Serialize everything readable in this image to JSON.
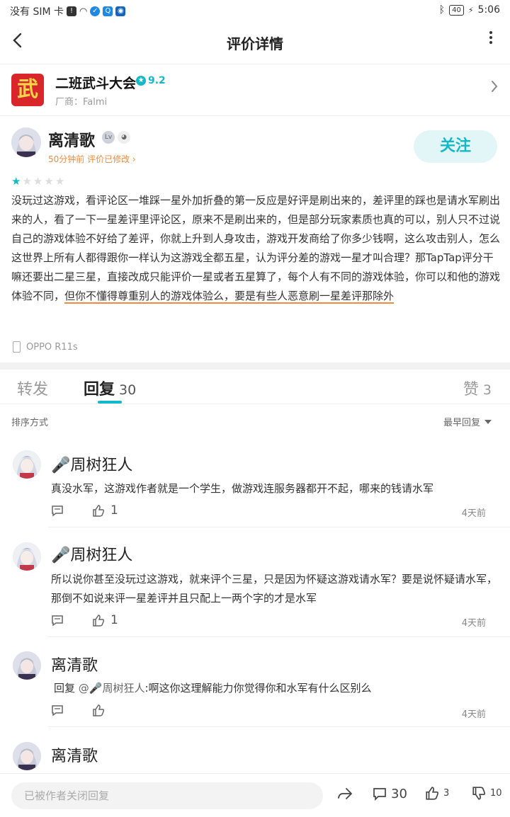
{
  "status_bar": {
    "carrier": "没有 SIM 卡",
    "battery": "40",
    "time": "5:06"
  },
  "header": {
    "title": "评价详情"
  },
  "game": {
    "icon_text": "武",
    "name": "二班武斗大会",
    "rating": "9.2",
    "vendor": "厂商：Falmi"
  },
  "review": {
    "author": "离清歌",
    "meta": "50分钟前 评价已修改",
    "follow_label": "关注",
    "stars_on": 1,
    "stars_total": 5,
    "body_part1": "没玩过这游戏，看评论区一堆踩一星外加折叠的第一反应是好评是刷出来的，差评里的踩也是请水军刷出来的人，看了一下一星差评里评论区，原来不是刷出来的，但是部分玩家素质也真的可以，别人只不过说自己的游戏体验不好给了差评，你就上升到人身攻击，游戏开发商给了你多少钱啊，这么攻击别人，怎么这世界上所有人都得跟你一样认为这游戏全都五星，认为评分差的游戏一星才叫合理？那TapTap评分干嘛还要出二星三星，直接改成只能评价一星或者五星算了，每个人有不同的游戏体验，你可以和他的游戏体验不同，",
    "body_part2": "但你不懂得尊重别人的游戏体验么，要是有些人恶意刷一星差评那除外",
    "device": "OPPO R11s"
  },
  "tabs": {
    "forward": "转发",
    "reply": "回复",
    "reply_count": "30",
    "like": "赞",
    "like_count": "3"
  },
  "sort": {
    "label": "排序方式",
    "current": "最早回复"
  },
  "comments": [
    {
      "author": "🎤周树狂人",
      "text": "真没水军，这游戏作者就是一个学生，做游戏连服务器都开不起，哪来的钱请水军",
      "likes": "1",
      "time": "4天前"
    },
    {
      "author": "🎤周树狂人",
      "text": "所以说你甚至没玩过这游戏，就来评个三星，只是因为怀疑这游戏请水军？要是说怀疑请水军，那倒不如说来评一星差评并且只配上一两个字的才是水军",
      "likes": "1",
      "time": "4天前"
    },
    {
      "author": "离清歌",
      "reply_prefix": "回复 ",
      "mention": "@🎤周树狂人",
      "text": ":啊这你这理解能力你觉得你和水军有什么区别么",
      "likes": "",
      "time": "4天前"
    },
    {
      "author": "离清歌"
    }
  ],
  "bottom_bar": {
    "reply_placeholder": "已被作者关闭回复",
    "comment_count": "30",
    "like_count": "3",
    "dislike_count": "10"
  },
  "colors": {
    "accent": "#14b9c8",
    "orange": "#f08a3c",
    "brand_red": "#d9262a"
  }
}
